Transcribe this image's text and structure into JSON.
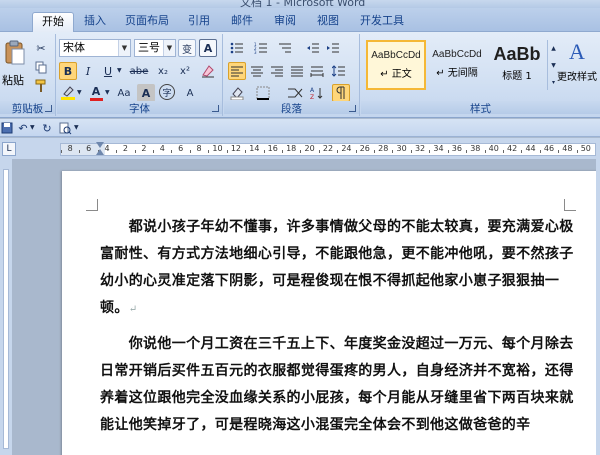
{
  "window": {
    "title": "文档 1 - Microsoft Word"
  },
  "tabs": [
    {
      "label": "开始",
      "active": true
    },
    {
      "label": "插入"
    },
    {
      "label": "页面布局"
    },
    {
      "label": "引用"
    },
    {
      "label": "邮件"
    },
    {
      "label": "审阅"
    },
    {
      "label": "视图"
    },
    {
      "label": "开发工具"
    }
  ],
  "ribbon": {
    "clipboard": {
      "label": "剪贴板",
      "paste_label": "粘贴"
    },
    "font": {
      "label": "字体",
      "font_name": "宋体",
      "font_size": "三号",
      "grow_icon": "A",
      "shrink_icon": "A",
      "wen_label": "变",
      "border_a": "A",
      "bold": "B",
      "italic": "I",
      "underline": "U",
      "strike": "abe",
      "subscript": "x₂",
      "superscript": "x²",
      "change_case": "Aa",
      "font_color_a": "A",
      "char_shade": "A",
      "enclose": "字"
    },
    "paragraph": {
      "label": "段落"
    },
    "styles": {
      "label": "样式",
      "items": [
        {
          "sample": "AaBbCcDd",
          "name": "↵ 正文",
          "selected": true
        },
        {
          "sample": "AaBbCcDd",
          "name": "↵ 无间隔"
        },
        {
          "sample": "AaBb",
          "name": "标题 1"
        }
      ],
      "change_styles": "更改样式"
    }
  },
  "ruler": {
    "numbers": [
      "8",
      "6",
      "4",
      "2",
      "2",
      "4",
      "6",
      "8",
      "10",
      "12",
      "14",
      "16",
      "18",
      "20",
      "22",
      "24",
      "26",
      "28",
      "30",
      "32",
      "34",
      "36",
      "38",
      "40",
      "42",
      "44",
      "46",
      "48",
      "50"
    ]
  },
  "document": {
    "paragraphs": [
      "　　都说小孩子年幼不懂事，许多事情做父母的不能太较真，要充满爱心极富耐性、有方式方法地细心引导，不能跟他急，更不能冲他吼，要不然孩子幼小的心灵准定落下阴影，可是程俊现在恨不得抓起他家小崽子狠狠抽一顿。",
      "　　你说他一个月工资在三千五上下、年度奖金没超过一万元、每个月除去日常开销后买件五百元的衣服都觉得蛋疼的男人，自身经济并不宽裕，还得养着这位跟他完全没血缘关系的小屁孩，每个月能从牙缝里省下两百块来就能让他笑掉牙了，可是程晓海这小混蛋完全体会不到他这做爸爸的辛"
    ],
    "para_mark": "↵"
  },
  "colors": {
    "ribbon_text": "#15428b",
    "highlight_yellow": "#ffe400",
    "font_red": "#e02020"
  }
}
